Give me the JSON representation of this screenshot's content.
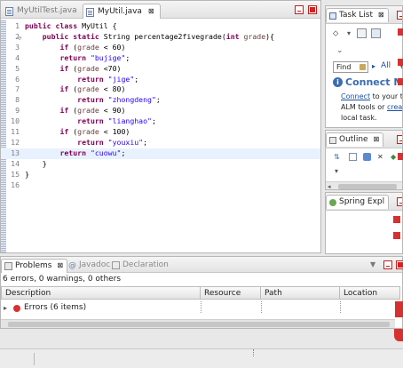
{
  "editor": {
    "tabs": [
      {
        "label": "MyUtilTest.java"
      },
      {
        "label": "MyUtil.java",
        "close": "⊠"
      }
    ],
    "lines": [
      {
        "n": "1",
        "segs": [
          [
            "kw",
            "public "
          ],
          [
            "kw",
            "class "
          ],
          [
            "cw",
            "MyUtil {"
          ]
        ]
      },
      {
        "n": "2",
        "segs": [
          [
            "cw",
            "    "
          ],
          [
            "kw",
            "public "
          ],
          [
            "kw",
            "static "
          ],
          [
            "cw",
            "String percentage2fivegrade("
          ],
          [
            "kw",
            "int "
          ],
          [
            "var",
            "grade"
          ],
          [
            "cw",
            "){"
          ]
        ]
      },
      {
        "n": "3",
        "segs": [
          [
            "cw",
            "        "
          ],
          [
            "kw",
            "if "
          ],
          [
            "cw",
            "("
          ],
          [
            "var",
            "grade"
          ],
          [
            "cw",
            " < 60)"
          ]
        ]
      },
      {
        "n": "4",
        "segs": [
          [
            "cw",
            "        "
          ],
          [
            "kw",
            "return "
          ],
          [
            "str",
            "\"bujige\""
          ],
          [
            "cw",
            ";"
          ]
        ]
      },
      {
        "n": "5",
        "segs": [
          [
            "cw",
            "        "
          ],
          [
            "kw",
            "if "
          ],
          [
            "cw",
            "("
          ],
          [
            "var",
            "grade"
          ],
          [
            "cw",
            " <70)"
          ]
        ]
      },
      {
        "n": "6",
        "segs": [
          [
            "cw",
            "            "
          ],
          [
            "kw",
            "return "
          ],
          [
            "str",
            "\"jige\""
          ],
          [
            "cw",
            ";"
          ]
        ]
      },
      {
        "n": "7",
        "segs": [
          [
            "cw",
            "        "
          ],
          [
            "kw",
            "if "
          ],
          [
            "cw",
            "("
          ],
          [
            "var",
            "grade"
          ],
          [
            "cw",
            " < 80)"
          ]
        ]
      },
      {
        "n": "8",
        "segs": [
          [
            "cw",
            "            "
          ],
          [
            "kw",
            "return "
          ],
          [
            "str",
            "\"zhongdeng\""
          ],
          [
            "cw",
            ";"
          ]
        ]
      },
      {
        "n": "9",
        "segs": [
          [
            "cw",
            "        "
          ],
          [
            "kw",
            "if "
          ],
          [
            "cw",
            "("
          ],
          [
            "var",
            "grade"
          ],
          [
            "cw",
            " < 90)"
          ]
        ]
      },
      {
        "n": "10",
        "segs": [
          [
            "cw",
            "            "
          ],
          [
            "kw",
            "return "
          ],
          [
            "str",
            "\"lianghao\""
          ],
          [
            "cw",
            ";"
          ]
        ]
      },
      {
        "n": "11",
        "segs": [
          [
            "cw",
            "        "
          ],
          [
            "kw",
            "if "
          ],
          [
            "cw",
            "("
          ],
          [
            "var",
            "grade"
          ],
          [
            "cw",
            " < 100)"
          ]
        ]
      },
      {
        "n": "12",
        "segs": [
          [
            "cw",
            "            "
          ],
          [
            "kw",
            "return "
          ],
          [
            "str",
            "\"youxiu\""
          ],
          [
            "cw",
            ";"
          ]
        ]
      },
      {
        "n": "13",
        "segs": [
          [
            "cw",
            "        "
          ],
          [
            "kw",
            "return "
          ],
          [
            "str",
            "\"cuowu\""
          ],
          [
            "cw",
            ";"
          ]
        ],
        "highlight": true
      },
      {
        "n": "14",
        "segs": [
          [
            "cw",
            "    }"
          ]
        ]
      },
      {
        "n": "15",
        "segs": [
          [
            "cw",
            "}"
          ]
        ]
      },
      {
        "n": "16",
        "segs": []
      }
    ]
  },
  "tasklist": {
    "tab": "Task List",
    "find_placeholder": "Find",
    "all_label": "All",
    "connect_title": "Connect Mylyn",
    "connect_link": "Connect",
    "connect_rest1": " to your t",
    "connect_line2a": "ALM tools or ",
    "connect_link2": "crea",
    "connect_line3": "local task."
  },
  "outline": {
    "tab": "Outline"
  },
  "spring": {
    "tab": "Spring Expl"
  },
  "problems": {
    "tabs": [
      "Problems",
      "Javadoc",
      "Declaration"
    ],
    "summary": "6 errors, 0 warnings, 0 others",
    "columns": [
      "Description",
      "Resource",
      "Path",
      "Location"
    ],
    "row": "Errors (6 items)"
  },
  "colors": {
    "error": "#d83030",
    "keyword": "#7f0055",
    "string": "#2a00ff",
    "link": "#1a4fa3",
    "connect": "#3b6cb0"
  }
}
